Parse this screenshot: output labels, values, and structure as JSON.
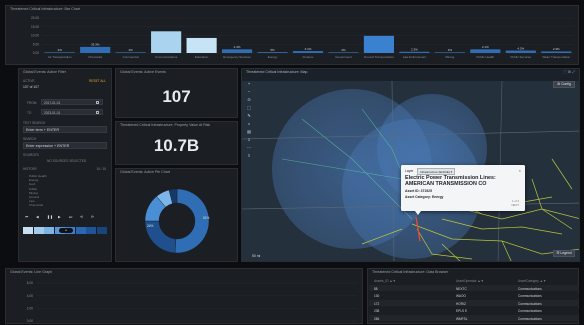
{
  "bar_panel": {
    "title": "Threatened Critical Infrastructure: Bar Chart",
    "y_ticks": [
      "20.00",
      "15.00",
      "10.00",
      "5.00",
      "0.00"
    ]
  },
  "chart_data": {
    "type": "bar",
    "title": "Threatened Critical Infrastructure: Bar Chart",
    "categories": [
      "Air Transportation",
      "Chemicals",
      "Commercial",
      "Communications",
      "Education",
      "Emergency Services",
      "Energy",
      "Finance",
      "Government",
      "Ground Transportation",
      "Law Enforcement",
      "Mining",
      "Public Health",
      "Public Services",
      "Water Transportation"
    ],
    "values": [
      0.4,
      3.5,
      0.4,
      12.4,
      8.6,
      2.1,
      0.5,
      1.1,
      0.4,
      9.8,
      0.7,
      0.4,
      2.1,
      1.4,
      0.9
    ],
    "data_labels": [
      "4%",
      "33.3%",
      "4%",
      "",
      "",
      "2.4%",
      "5%",
      "3.1%",
      "4%",
      "",
      "2.3%",
      "4%",
      "2.1%",
      "4.2%",
      "2.3%"
    ],
    "ylim": [
      0,
      20
    ],
    "bar_colors": [
      "#2f6eb5",
      "#2f6eb5",
      "#2f6eb5",
      "#a9d3ef",
      "#c7e4f6",
      "#2f6eb5",
      "#2f6eb5",
      "#2f6eb5",
      "#2f6eb5",
      "#3a82cf",
      "#2f6eb5",
      "#2f6eb5",
      "#2f6eb5",
      "#2f6eb5",
      "#2f6eb5"
    ]
  },
  "filter": {
    "title": "Global Events: Active Filter",
    "reset_label": "RESET ALL",
    "status_label": "ACTIVE",
    "status_value": "107 of 107",
    "from_label": "FROM",
    "from_value": "2017-01-01",
    "to_label": "TO",
    "to_value": "2023-01-01",
    "text_search_label": "TEXT SEARCH",
    "text_search_placeholder": "Enter term + ENTER",
    "search_label": "SEARCH",
    "search_placeholder": "Enter expression + ENTER",
    "sources_label": "SOURCES",
    "sources_value": "NO SOURCES SELECTED",
    "history_label": "HISTORY",
    "history_count": "15 / 15",
    "history_items": [
      "Public Health",
      "Energy",
      "Govt",
      "Public",
      "Mining",
      "Ground",
      "Law",
      "Chemicals"
    ],
    "controls": [
      "⏮",
      "◀",
      "❚❚",
      "▶",
      "⏭",
      "⟲",
      "⟳"
    ],
    "toggle_label": "●"
  },
  "kpi_active": {
    "title": "Global Events: Active Events",
    "value": "107"
  },
  "kpi_damage": {
    "title": "Threatened Critical Infrastructure: Property Value At Risk",
    "value": "10.7B"
  },
  "pie_panel": {
    "title": "Global Events: Active Pie Chart",
    "slices": [
      {
        "value": 51,
        "color": "#2f6eb5"
      },
      {
        "value": 24,
        "color": "#1f4f8c"
      },
      {
        "value": 14,
        "color": "#4a8fd6"
      },
      {
        "value": 7,
        "color": "#7cb5e8"
      },
      {
        "value": 4,
        "color": "#163a68"
      }
    ],
    "labels": [
      "51%",
      "24%"
    ]
  },
  "map": {
    "title": "Threatened Critical Infrastructure: Map",
    "config_label": "⚙ Config",
    "legend_label": "☰ Legend",
    "tools": [
      "+",
      "−",
      "⊙",
      "⬚",
      "✎",
      "⌂",
      "▤",
      "⇩",
      "⋯",
      "≡"
    ],
    "scale_label": "50 mi",
    "top_icons": "⬚ ⚙ ⤢"
  },
  "popup": {
    "layer_label": "Layer",
    "layer_value": "Infrastructure (ENGIE) ▾",
    "close": "×",
    "title": "Electric Power Transmission Lines: AMERICAN TRANSMISSION CO",
    "asset_id": "Asset ID: 371925",
    "category": "Asset Category: Energy",
    "pager": "1 of 4",
    "next": "NEXT"
  },
  "line_panel": {
    "title": "Global Events: Line Graph",
    "y_ticks": [
      "6.00",
      "4.00",
      "2.00",
      "0.00"
    ]
  },
  "table": {
    "title": "Threatened Critical Infrastructure: Data Browser",
    "columns": [
      "Assets_ID ▲▼",
      "AssetOperator ▲▼",
      "AssetCategory ▲▼"
    ],
    "rows": [
      [
        "88",
        "NEXTC",
        "Communications"
      ],
      [
        "130",
        "WAOO",
        "Communications"
      ],
      [
        "172",
        "HORIZ",
        "Communications"
      ],
      [
        "238",
        "EPLS E",
        "Communications"
      ],
      [
        "284",
        "WMFSL",
        "Communications"
      ]
    ]
  }
}
